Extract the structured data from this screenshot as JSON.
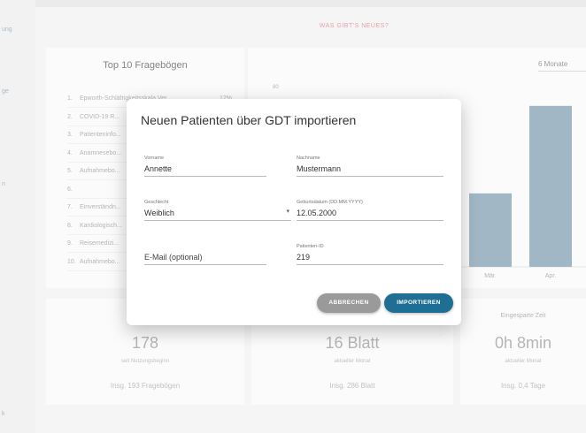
{
  "sidebar": {
    "items": [
      {
        "label": "ung",
        "top": 0
      },
      {
        "label": "ge"
      },
      {
        "label": "n"
      },
      {
        "label": "k"
      }
    ]
  },
  "banner": {
    "text": "WAS GIBT'S NEUES?"
  },
  "top_list": {
    "title": "Top 10 Fragebögen",
    "items": [
      {
        "index": "1.",
        "name": "Epworth-Schläfrigkeitsskala Ver...",
        "pct": "12%"
      },
      {
        "index": "2.",
        "name": "COVID-19 R...",
        "pct": ""
      },
      {
        "index": "3.",
        "name": "Patienteninfo...",
        "pct": ""
      },
      {
        "index": "4.",
        "name": "Anamnesebo...",
        "pct": ""
      },
      {
        "index": "5.",
        "name": "Aufnahmebo...",
        "pct": ""
      },
      {
        "index": "6.",
        "name": "",
        "pct": ""
      },
      {
        "index": "7.",
        "name": "Einverständn...",
        "pct": ""
      },
      {
        "index": "8.",
        "name": "Kardiologisch...",
        "pct": ""
      },
      {
        "index": "9.",
        "name": "Reisemedizi...",
        "pct": ""
      },
      {
        "index": "10.",
        "name": "Aufnahmebo...",
        "pct": ""
      }
    ]
  },
  "chart_panel": {
    "period": "6 Monate",
    "chart_data": {
      "type": "bar",
      "categories": [
        "Mär.",
        "Apr."
      ],
      "values": [
        42,
        92
      ],
      "ylim": [
        0,
        100
      ],
      "y_tick_label": "80"
    }
  },
  "stats": [
    {
      "title": "",
      "value": "178",
      "sub": "seit Nutzungsbeginn",
      "total": "Insg. 193 Fragebögen"
    },
    {
      "title": "",
      "value": "16 Blatt",
      "sub": "aktueller Monat",
      "total": "Insg. 286 Blatt"
    },
    {
      "title": "Eingesparte Zeit",
      "value": "0h 8min",
      "sub": "aktueller Monat",
      "total": "Insg. 0,4 Tage"
    }
  ],
  "dialog": {
    "title": "Neuen Patienten über GDT importieren",
    "fields": {
      "firstname": {
        "label": "Vorname",
        "value": "Annette"
      },
      "lastname": {
        "label": "Nachname",
        "value": "Mustermann"
      },
      "gender": {
        "label": "Geschlecht",
        "value": "Weiblich"
      },
      "birthdate": {
        "label": "Geburtsdatum (DD.MM.YYYY)",
        "value": "12.05.2000"
      },
      "email": {
        "label": "",
        "value": "E-Mail (optional)"
      },
      "patient_id": {
        "label": "Patienten-ID",
        "value": "219"
      }
    },
    "cancel_label": "ABBRECHEN",
    "import_label": "IMPORTIEREN"
  }
}
